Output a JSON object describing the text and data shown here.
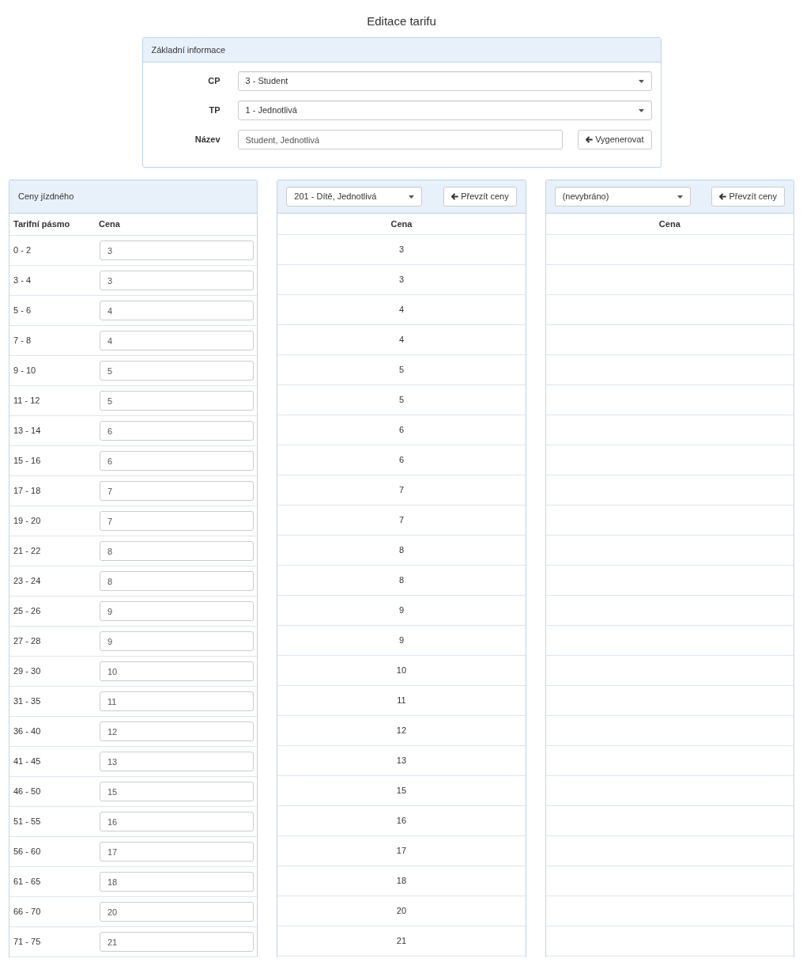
{
  "page_title": "Editace tarifu",
  "basic_info": {
    "title": "Základní informace",
    "fields": [
      {
        "kind": "select",
        "label": "CP",
        "value": "3 - Student"
      },
      {
        "kind": "select",
        "label": "TP",
        "value": "1 - Jednotlivá"
      },
      {
        "kind": "text",
        "label": "Název",
        "value": "Student, Jednotlivá",
        "button": "Vygenerovat"
      }
    ]
  },
  "fares": {
    "title": "Ceny jízdného",
    "columns": [
      "Tarifní pásmo",
      "Cena"
    ],
    "rows": [
      {
        "zone": "0 - 2",
        "price": "3"
      },
      {
        "zone": "3 - 4",
        "price": "3"
      },
      {
        "zone": "5 - 6",
        "price": "4"
      },
      {
        "zone": "7 - 8",
        "price": "4"
      },
      {
        "zone": "9 - 10",
        "price": "5"
      },
      {
        "zone": "11 - 12",
        "price": "5"
      },
      {
        "zone": "13 - 14",
        "price": "6"
      },
      {
        "zone": "15 - 16",
        "price": "6"
      },
      {
        "zone": "17 - 18",
        "price": "7"
      },
      {
        "zone": "19 - 20",
        "price": "7"
      },
      {
        "zone": "21 - 22",
        "price": "8"
      },
      {
        "zone": "23 - 24",
        "price": "8"
      },
      {
        "zone": "25 - 26",
        "price": "9"
      },
      {
        "zone": "27 - 28",
        "price": "9"
      },
      {
        "zone": "29 - 30",
        "price": "10"
      },
      {
        "zone": "31 - 35",
        "price": "11"
      },
      {
        "zone": "36 - 40",
        "price": "12"
      },
      {
        "zone": "41 - 45",
        "price": "13"
      },
      {
        "zone": "46 - 50",
        "price": "15"
      },
      {
        "zone": "51 - 55",
        "price": "16"
      },
      {
        "zone": "56 - 60",
        "price": "17"
      },
      {
        "zone": "61 - 65",
        "price": "18"
      },
      {
        "zone": "66 - 70",
        "price": "20"
      },
      {
        "zone": "71 - 75",
        "price": "21"
      }
    ]
  },
  "compare_panels": [
    {
      "select": "201 - Dítě, Jednotlivá",
      "button": "Převzít ceny",
      "column": "Cena",
      "prices": [
        "3",
        "3",
        "4",
        "4",
        "5",
        "5",
        "6",
        "6",
        "7",
        "7",
        "8",
        "8",
        "9",
        "9",
        "10",
        "11",
        "12",
        "13",
        "15",
        "16",
        "17",
        "18",
        "20",
        "21"
      ]
    },
    {
      "select": "(nevybráno)",
      "button": "Převzít ceny",
      "column": "Cena"
    }
  ]
}
